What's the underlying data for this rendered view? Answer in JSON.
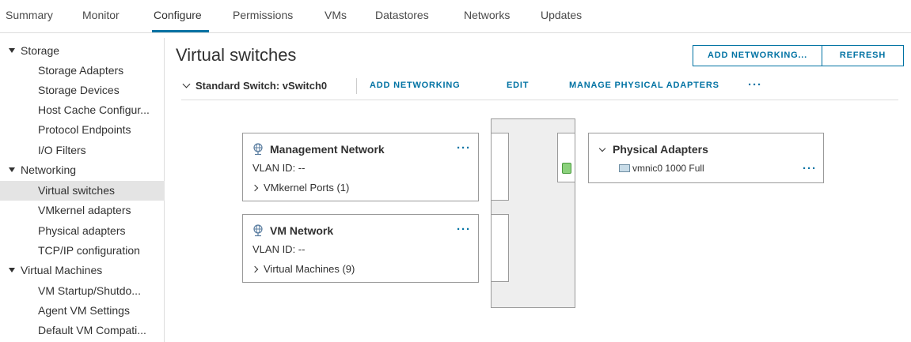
{
  "tabs": [
    {
      "label": "Summary"
    },
    {
      "label": "Monitor"
    },
    {
      "label": "Configure"
    },
    {
      "label": "Permissions"
    },
    {
      "label": "VMs"
    },
    {
      "label": "Datastores"
    },
    {
      "label": "Networks"
    },
    {
      "label": "Updates"
    }
  ],
  "active_tab": "Configure",
  "sidebar": {
    "groups": [
      {
        "label": "Storage",
        "items": [
          "Storage Adapters",
          "Storage Devices",
          "Host Cache Configur...",
          "Protocol Endpoints",
          "I/O Filters"
        ]
      },
      {
        "label": "Networking",
        "items": [
          "Virtual switches",
          "VMkernel adapters",
          "Physical adapters",
          "TCP/IP configuration"
        ]
      },
      {
        "label": "Virtual Machines",
        "items": [
          "VM Startup/Shutdo...",
          "Agent VM Settings",
          "Default VM Compati..."
        ]
      }
    ],
    "selected": "Virtual switches"
  },
  "page": {
    "title": "Virtual switches",
    "add_networking_button": "ADD NETWORKING...",
    "refresh_button": "REFRESH"
  },
  "switch": {
    "title": "Standard Switch: vSwitch0",
    "actions": [
      "ADD NETWORKING",
      "EDIT",
      "MANAGE PHYSICAL ADAPTERS"
    ],
    "more": "···"
  },
  "port_groups": [
    {
      "name": "Management Network",
      "vlan": "VLAN ID: --",
      "detail": "VMkernel Ports (1)",
      "more": "···"
    },
    {
      "name": "VM Network",
      "vlan": "VLAN ID: --",
      "detail": "Virtual Machines (9)",
      "more": "···"
    }
  ],
  "physical_adapters": {
    "title": "Physical Adapters",
    "nic": "vmnic0 1000 Full",
    "more": "···"
  },
  "colors": {
    "accent": "#0072a3",
    "selected_row": "#e4e4e4",
    "uplink_led": "#8bd17c"
  }
}
